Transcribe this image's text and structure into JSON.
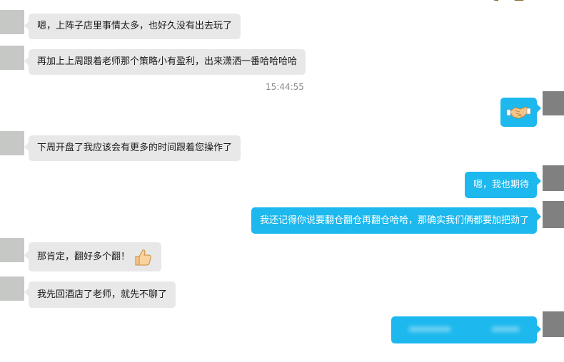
{
  "messages": [
    {
      "side": "in",
      "text": "嗯，上阵子店里事情太多，也好久没有出去玩了"
    },
    {
      "side": "in",
      "text": "再加上上周跟着老师那个策略小有盈利，出来潇洒一番哈哈哈哈"
    },
    {
      "timestamp": "15:44:55"
    },
    {
      "side": "out",
      "emoji": "handshake-icon"
    },
    {
      "side": "in",
      "text": "下周开盘了我应该会有更多的时间跟着您操作了"
    },
    {
      "side": "out",
      "text": "嗯，我也期待"
    },
    {
      "side": "out",
      "text": "我还记得你说要翻仓翻仓再翻仓哈哈，那确实我们俩都要加把劲了"
    },
    {
      "side": "in",
      "text": "那肯定，翻好多个翻！",
      "emoji": "thumbs-up-icon"
    },
    {
      "side": "in",
      "text": "我先回酒店了老师，就先不聊了"
    },
    {
      "side": "out",
      "text": ""
    }
  ],
  "colors": {
    "incoming_bubble": "#e8e8e8",
    "outgoing_bubble": "#1cb8ee",
    "timestamp": "#8a8a8a"
  }
}
